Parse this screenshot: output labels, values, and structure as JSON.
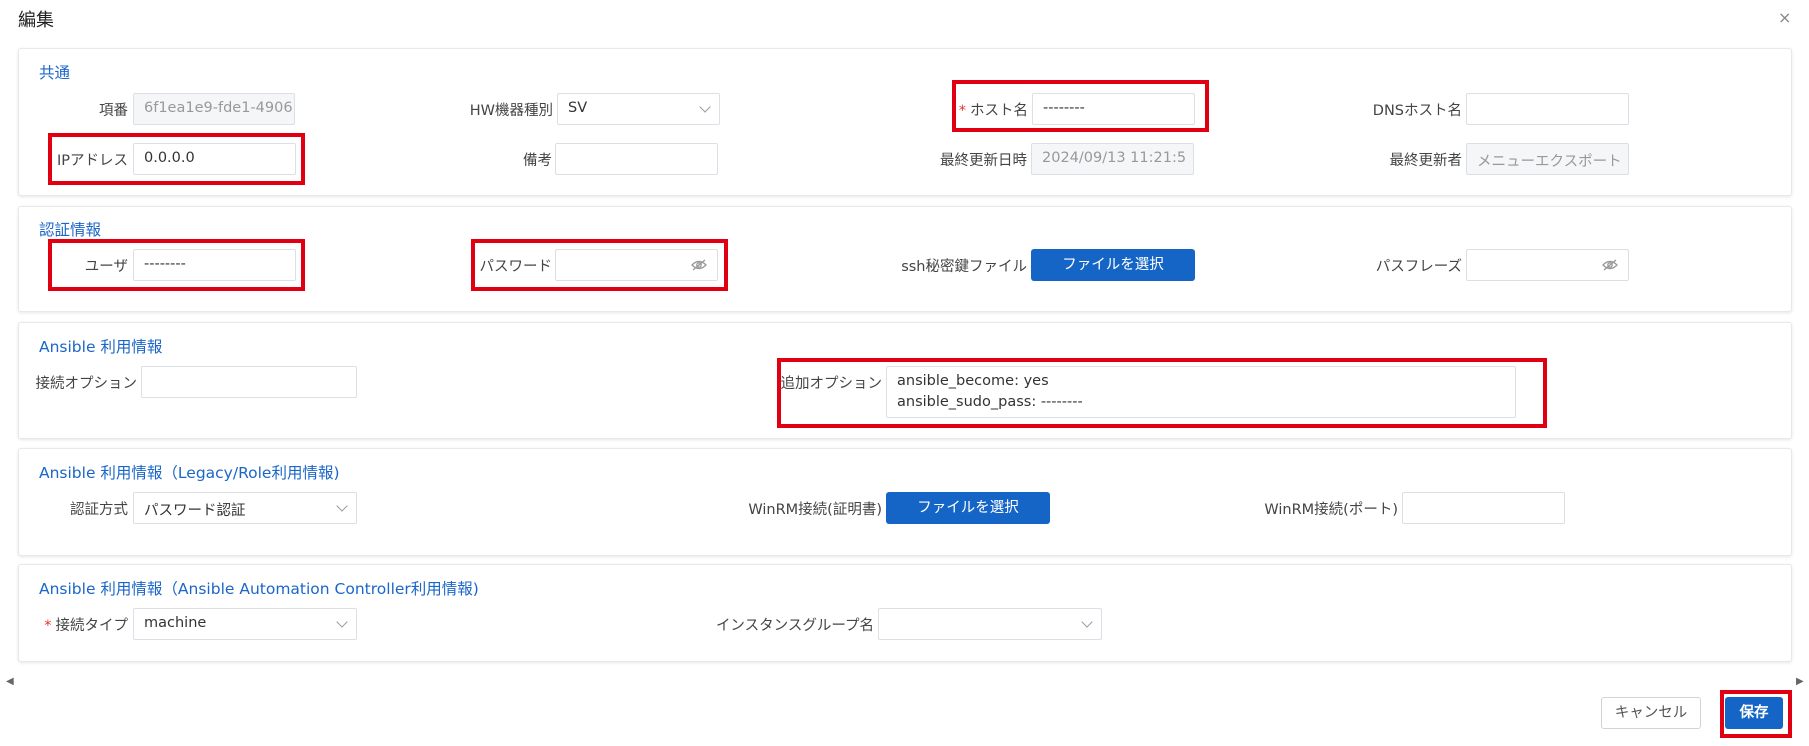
{
  "dialog": {
    "title": "編集",
    "close_glyph": "×"
  },
  "common": {
    "title": "共通",
    "item_no_label": "項番",
    "item_no_value": "6f1ea1e9-fde1-4906",
    "hw_type_label": "HW機器種別",
    "hw_type_value": "SV",
    "hostname_label": "ホスト名",
    "hostname_value": "--------",
    "dns_label": "DNSホスト名",
    "dns_value": "",
    "ip_label": "IPアドレス",
    "ip_value": "0.0.0.0",
    "note_label": "備考",
    "note_value": "",
    "updated_at_label": "最終更新日時",
    "updated_at_value": "2024/09/13 11:21:5",
    "updated_by_label": "最終更新者",
    "updated_by_value": "メニューエクスポート"
  },
  "auth": {
    "title": "認証情報",
    "user_label": "ユーザ",
    "user_value": "--------",
    "password_label": "パスワード",
    "password_value": "",
    "ssh_key_label": "ssh秘密鍵ファイル",
    "ssh_key_button": "ファイルを選択",
    "passphrase_label": "パスフレーズ",
    "passphrase_value": ""
  },
  "ansible": {
    "title": "Ansible 利用情報",
    "conn_option_label": "接続オプション",
    "conn_option_value": "",
    "extra_option_label": "追加オプション",
    "extra_option_value": "ansible_become: yes\nansible_sudo_pass: --------"
  },
  "legacy": {
    "title": "Ansible 利用情報（Legacy/Role利用情報)",
    "auth_method_label": "認証方式",
    "auth_method_value": "パスワード認証",
    "winrm_cert_label": "WinRM接続(証明書)",
    "winrm_cert_button": "ファイルを選択",
    "winrm_port_label": "WinRM接続(ポート)",
    "winrm_port_value": ""
  },
  "aac": {
    "title": "Ansible 利用情報（Ansible Automation Controller利用情報)",
    "conn_type_label": "接続タイプ",
    "conn_type_value": "machine",
    "instance_group_label": "インスタンスグループ名",
    "instance_group_value": ""
  },
  "footer": {
    "cancel_label": "キャンセル",
    "save_label": "保存"
  },
  "colors": {
    "accent": "#1565c6",
    "highlight": "#e00012",
    "required": "#e0332f"
  },
  "icons": {
    "password_toggle": "eye-off-icon",
    "select": "chevron-down-icon"
  }
}
